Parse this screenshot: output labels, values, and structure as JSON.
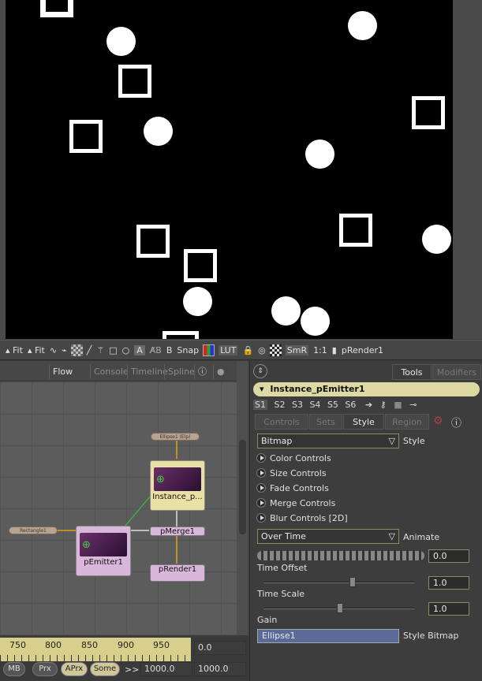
{
  "viewer_shapes": {
    "circles": "white circles",
    "squares": "white outlined squares"
  },
  "viewbar": {
    "fit1": "Fit",
    "fit2": "Fit",
    "snap": "Snap",
    "lut": "LUT",
    "smr": "SmR",
    "ratio": "1:1",
    "a": "A",
    "b": "B",
    "render": "pRender1"
  },
  "flow": {
    "tabs": [
      "Flow",
      "Console",
      "Timeline",
      "Spline"
    ],
    "nodes": {
      "ellipse": "Ellipse1 (Elp)",
      "rectangle": "Rectangle1",
      "instance": "Instance_p...",
      "merge": "pMerge1",
      "emitter": "pEmitter1",
      "render": "pRender1"
    }
  },
  "timeline": {
    "ticks": [
      "750",
      "800",
      "850",
      "900",
      "950"
    ],
    "current": "0.0",
    "mb": "MB",
    "prx": "Prx",
    "aprx": "APrx",
    "some": "Some",
    "arrows": ">>",
    "start": "1000.0",
    "end": "1000.0"
  },
  "inspector": {
    "top_tabs": [
      "Tools",
      "Modifiers"
    ],
    "tool_name": "Instance_pEmitter1",
    "sets": [
      "S1",
      "S2",
      "S3",
      "S4",
      "S5",
      "S6"
    ],
    "sub_tabs": [
      "Controls",
      "Sets",
      "Style",
      "Region"
    ],
    "style_value": "Bitmap",
    "style_label": "Style",
    "groups": [
      "Color Controls",
      "Size Controls",
      "Fade Controls",
      "Merge Controls",
      "Blur Controls [2D]"
    ],
    "animate_value": "Over Time",
    "animate_label": "Animate",
    "curve_value": "0.0",
    "time_offset_label": "Time Offset",
    "time_offset_value": "1.0",
    "time_scale_label": "Time Scale",
    "time_scale_value": "1.0",
    "gain_label": "Gain",
    "bitmap_value": "Ellipse1",
    "bitmap_label": "Style Bitmap"
  }
}
